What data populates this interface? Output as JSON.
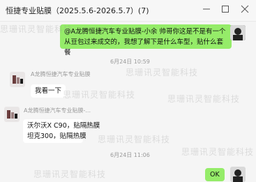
{
  "window": {
    "title": "恒捷专业贴膜（2025.5.6-2026.5.7）(7)"
  },
  "messages": [
    {
      "side": "right",
      "text": "@A龙腾恒捷汽车专业贴膜-小余 帅哥你这是不是有一个从豆包过来成交的，我想了解下是什么车型，贴什么套餐"
    },
    {
      "timestamp": "6月24日 10:59"
    },
    {
      "side": "left",
      "sender": "A龙腾恒捷汽车专业贴膜",
      "text": "我看一下"
    },
    {
      "side": "left",
      "sender": "A龙腾恒捷汽车专业贴膜-...",
      "lines": [
        "沃尔沃X C90，贴隔热膜",
        "坦克300，贴隔热膜"
      ]
    },
    {
      "timestamp": "6月24日 11:06"
    },
    {
      "side": "right",
      "text": "OK"
    }
  ],
  "watermark": {
    "text": "思珊讯灵智能科技"
  },
  "colors": {
    "own_bubble": "#95ec69",
    "other_bubble": "#ffffff",
    "background": "#f5f5f5"
  }
}
